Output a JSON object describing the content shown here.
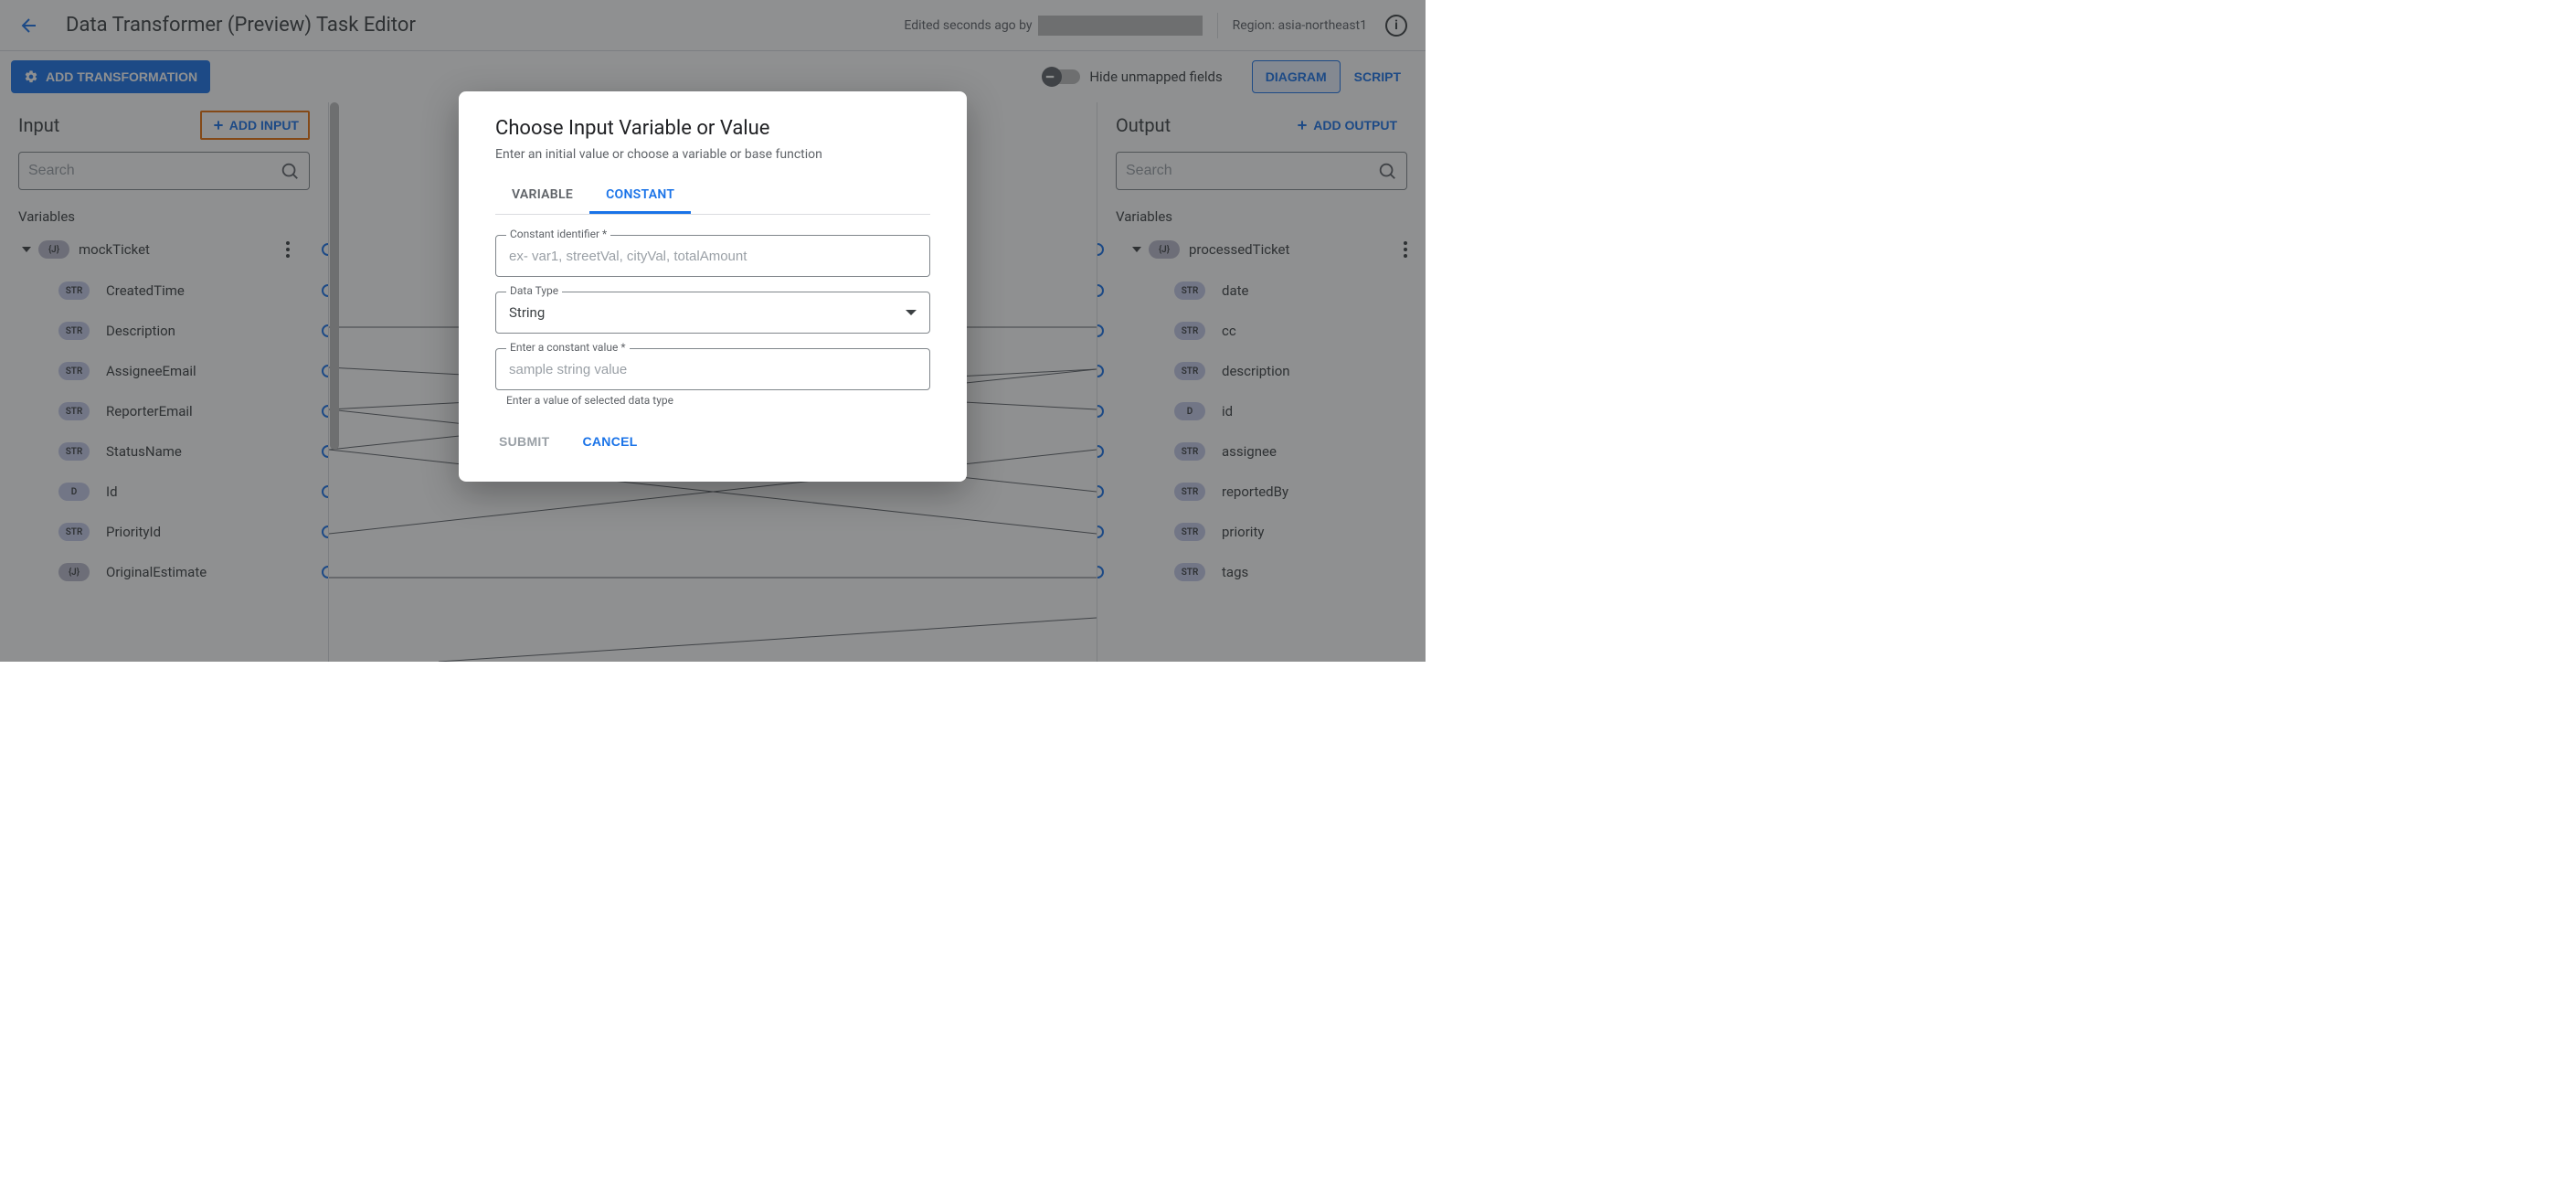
{
  "header": {
    "title": "Data Transformer (Preview) Task Editor",
    "edited_prefix": "Edited seconds ago by ",
    "region_label": "Region: asia-northeast1"
  },
  "toolbar": {
    "add_transformation": "ADD TRANSFORMATION",
    "hide_unmapped": "Hide unmapped fields",
    "view_diagram": "DIAGRAM",
    "view_script": "SCRIPT"
  },
  "input_panel": {
    "title": "Input",
    "add_label": "ADD INPUT",
    "search_placeholder": "Search",
    "section": "Variables",
    "root": "mockTicket",
    "root_type": "{J}",
    "fields": [
      {
        "type": "STR",
        "name": "CreatedTime"
      },
      {
        "type": "STR",
        "name": "Description"
      },
      {
        "type": "STR",
        "name": "AssigneeEmail"
      },
      {
        "type": "STR",
        "name": "ReporterEmail"
      },
      {
        "type": "STR",
        "name": "StatusName"
      },
      {
        "type": "D",
        "name": "Id"
      },
      {
        "type": "STR",
        "name": "PriorityId"
      },
      {
        "type": "{J}",
        "name": "OriginalEstimate"
      }
    ]
  },
  "output_panel": {
    "title": "Output",
    "add_label": "ADD OUTPUT",
    "search_placeholder": "Search",
    "section": "Variables",
    "root": "processedTicket",
    "root_type": "{J}",
    "fields": [
      {
        "type": "STR",
        "name": "date"
      },
      {
        "type": "STR",
        "name": "cc"
      },
      {
        "type": "STR",
        "name": "description"
      },
      {
        "type": "D",
        "name": "id"
      },
      {
        "type": "STR",
        "name": "assignee"
      },
      {
        "type": "STR",
        "name": "reportedBy"
      },
      {
        "type": "STR",
        "name": "priority"
      },
      {
        "type": "STR",
        "name": "tags"
      }
    ]
  },
  "modal": {
    "title": "Choose Input Variable or Value",
    "subtitle": "Enter an initial value or choose a variable or base function",
    "tab_variable": "VARIABLE",
    "tab_constant": "CONSTANT",
    "identifier_label": "Constant identifier *",
    "identifier_placeholder": "ex- var1, streetVal, cityVal, totalAmount",
    "datatype_label": "Data Type",
    "datatype_value": "String",
    "value_label": "Enter a constant value *",
    "value_placeholder": "sample string value",
    "value_help": "Enter a value of selected data type",
    "submit": "SUBMIT",
    "cancel": "CANCEL"
  }
}
